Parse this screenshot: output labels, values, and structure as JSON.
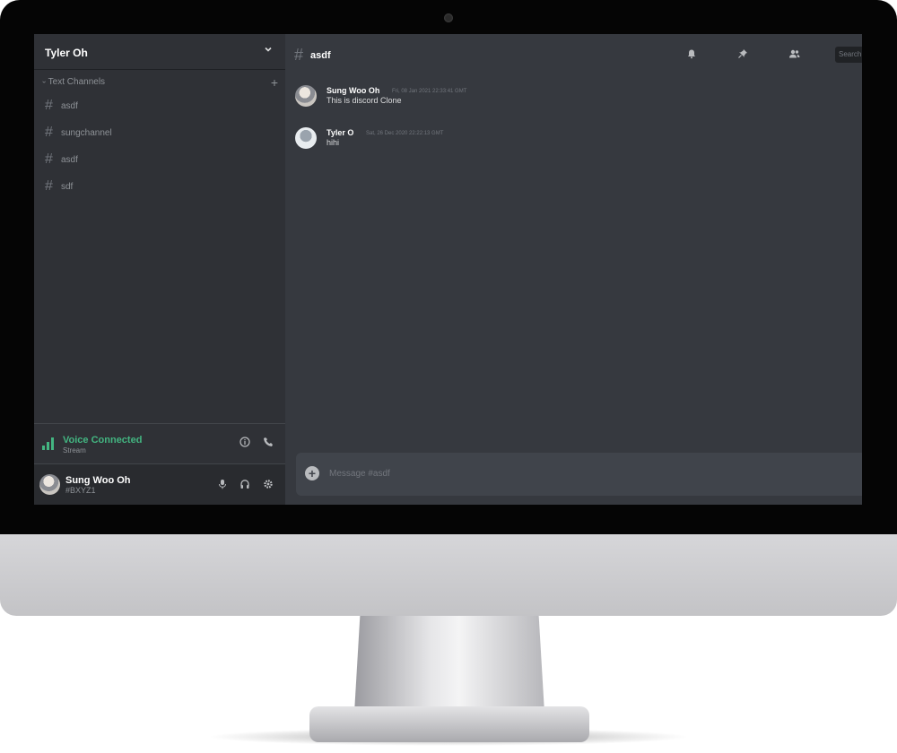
{
  "server": {
    "name": "Tyler Oh"
  },
  "sidebar": {
    "section_title": "Text Channels",
    "channels": [
      {
        "name": "asdf"
      },
      {
        "name": "sungchannel"
      },
      {
        "name": "asdf"
      },
      {
        "name": "sdf"
      }
    ]
  },
  "voice": {
    "status": "Voice Connected",
    "sub": "Stream"
  },
  "user": {
    "name": "Sung Woo Oh",
    "tag": "#BXYZ1"
  },
  "chat": {
    "channel": "asdf",
    "search_placeholder": "Search",
    "messages": [
      {
        "author": "Sung Woo Oh",
        "timestamp": "Fri, 08 Jan 2021 22:33:41 GMT",
        "text": "This is discord Clone"
      },
      {
        "author": "Tyler O",
        "timestamp": "Sat, 26 Dec 2020 22:22:13 GMT",
        "text": "hihi"
      }
    ],
    "composer_placeholder": "Message #asdf"
  },
  "colors": {
    "accent_green": "#43b581",
    "bg_main": "#36393f",
    "bg_sidebar": "#2f3136"
  },
  "icons": [
    "chevron-down-icon",
    "hash-icon",
    "plus-icon",
    "signal-icon",
    "info-icon",
    "phone-icon",
    "mic-icon",
    "headphones-icon",
    "gear-icon",
    "bell-icon",
    "pin-icon",
    "members-icon",
    "add-circle-icon"
  ]
}
